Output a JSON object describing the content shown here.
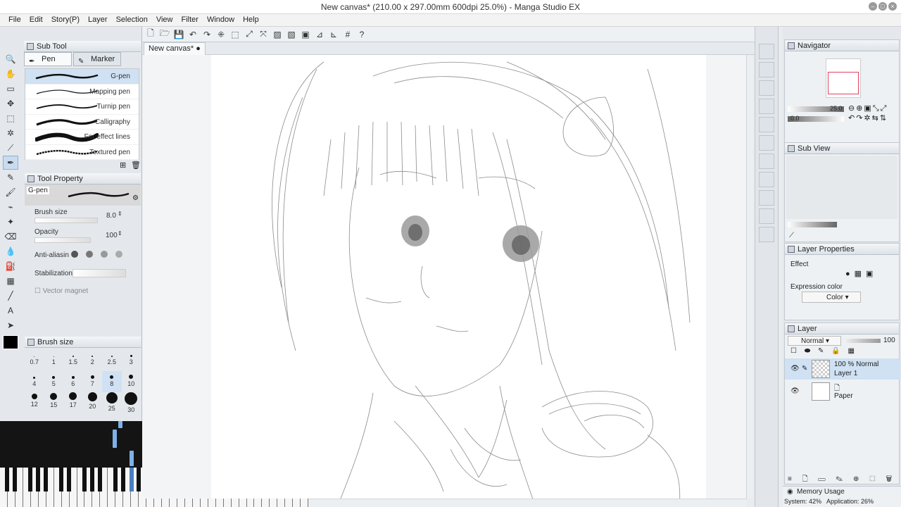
{
  "window": {
    "title": "New canvas* (210.00 x 297.00mm 600dpi 25.0%) - Manga Studio EX"
  },
  "menu": [
    "File",
    "Edit",
    "Story(P)",
    "Layer",
    "Selection",
    "View",
    "Filter",
    "Window",
    "Help"
  ],
  "subtool": {
    "header": "Sub Tool",
    "tabs": [
      {
        "label": "Pen"
      },
      {
        "label": "Marker"
      }
    ],
    "brushes": [
      {
        "label": "G-pen",
        "selected": true
      },
      {
        "label": "Mapping pen",
        "selected": false
      },
      {
        "label": "Turnip pen",
        "selected": false
      },
      {
        "label": "Calligraphy",
        "selected": false
      },
      {
        "label": "For effect lines",
        "selected": false
      },
      {
        "label": "Textured pen",
        "selected": false
      }
    ]
  },
  "tool_property": {
    "header": "Tool Property",
    "tool_name": "G-pen",
    "brush_size_label": "Brush size",
    "brush_size_value": "8.0",
    "opacity_label": "Opacity",
    "opacity_value": "100",
    "antialias_label": "Anti-aliasin",
    "stabilization_label": "Stabilization",
    "vector_magnet_label": "Vector magnet"
  },
  "brush_size_panel": {
    "header": "Brush size",
    "sizes": [
      "0.7",
      "1",
      "1.5",
      "2",
      "2.5",
      "3",
      "4",
      "5",
      "6",
      "7",
      "8",
      "10",
      "12",
      "15",
      "17",
      "20",
      "25",
      "30"
    ]
  },
  "document": {
    "tab_label": "New canvas*"
  },
  "navigator": {
    "header": "Navigator",
    "zoom": "25.0",
    "rotation": "0.0"
  },
  "subview": {
    "header": "Sub View"
  },
  "layer_properties": {
    "header": "Layer Properties",
    "effect_label": "Effect",
    "expression_color_label": "Expression color",
    "expression_color_value": "Color"
  },
  "layer_panel": {
    "header": "Layer",
    "blend_mode": "Normal",
    "opacity": "100",
    "layers": [
      {
        "line1": "100 %  Normal",
        "line2": "Layer 1",
        "selected": true
      },
      {
        "line1": "",
        "line2": "Paper",
        "selected": false
      }
    ]
  },
  "memory": {
    "header": "Memory Usage",
    "system": "System: 42%",
    "application": "Application: 26%"
  },
  "colors": {
    "accent": "#cfe1f3",
    "panel": "#e4e8ec"
  }
}
